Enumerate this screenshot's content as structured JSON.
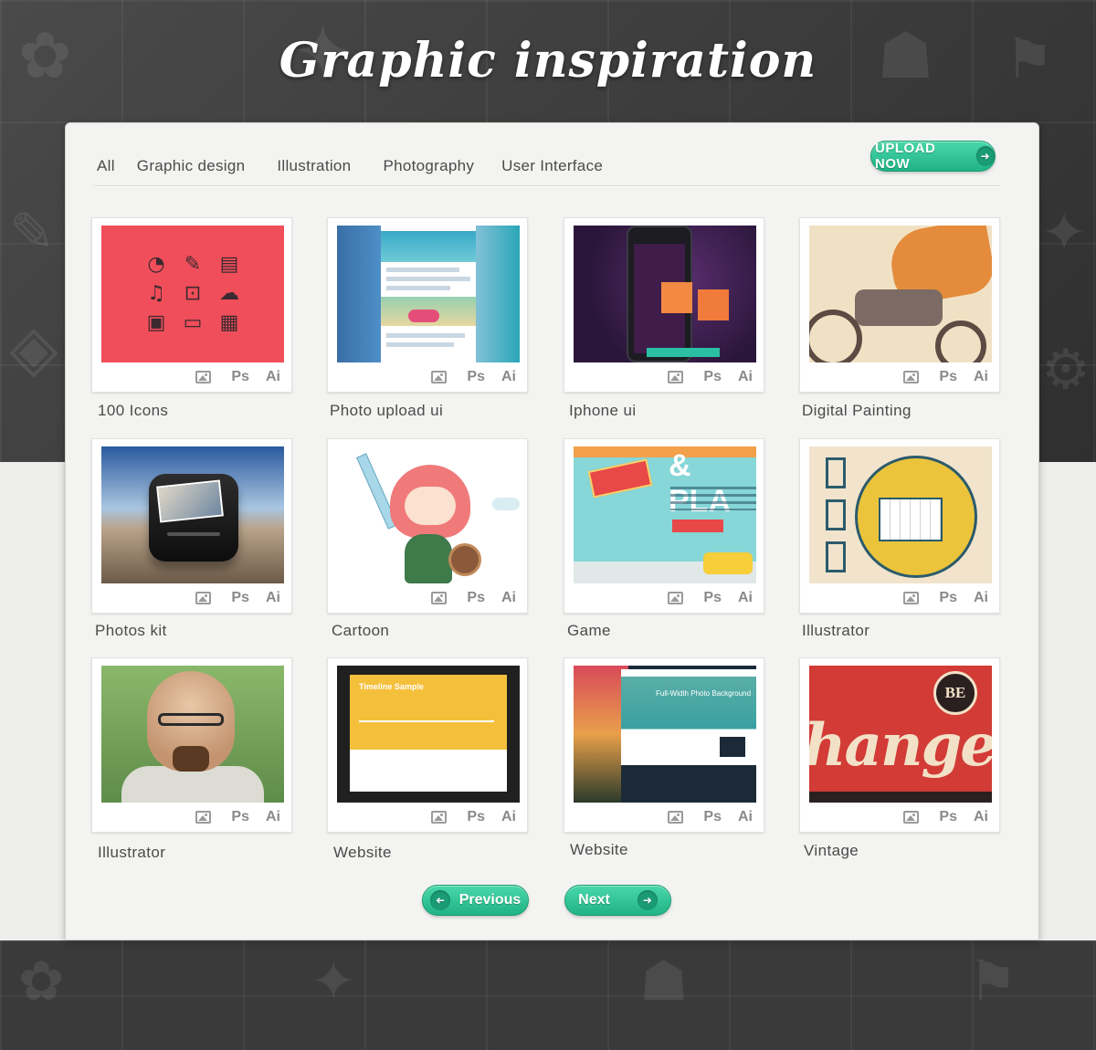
{
  "header": {
    "title": "Graphic inspiration"
  },
  "tabs": [
    {
      "label": "All"
    },
    {
      "label": "Graphic design"
    },
    {
      "label": "Illustration"
    },
    {
      "label": "Photography"
    },
    {
      "label": "User Interface"
    }
  ],
  "upload_button": {
    "label": "UPLOAD NOW",
    "icon": "arrow-right-icon"
  },
  "card_tools": {
    "image_icon": "image-icon",
    "ps_label": "Ps",
    "ai_label": "Ai"
  },
  "gallery": [
    {
      "caption": "100 Icons",
      "thumb": "icons"
    },
    {
      "caption": "Photo upload ui",
      "thumb": "upload"
    },
    {
      "caption": "Iphone ui",
      "thumb": "iphone"
    },
    {
      "caption": "Digital Painting",
      "thumb": "paint"
    },
    {
      "caption": "Photos kit",
      "thumb": "photokit"
    },
    {
      "caption": "Cartoon",
      "thumb": "cartoon"
    },
    {
      "caption": "Game",
      "thumb": "game"
    },
    {
      "caption": "Illustrator",
      "thumb": "illus1"
    },
    {
      "caption": "Illustrator",
      "thumb": "heisen"
    },
    {
      "caption": "Website",
      "thumb": "timeline"
    },
    {
      "caption": "Website",
      "thumb": "website2"
    },
    {
      "caption": "Vintage",
      "thumb": "vintage"
    }
  ],
  "thumb_text": {
    "game_word": "& PLA",
    "timeline_title": "Timeline Sample",
    "website_title": "Full-Width Photo Background",
    "vintage_badge": "BE",
    "vintage_word": "hange"
  },
  "pagination": {
    "previous_label": "Previous",
    "next_label": "Next",
    "previous_icon": "arrow-left-icon",
    "next_icon": "arrow-right-icon"
  },
  "colors": {
    "accent": "#2ac28f",
    "background_dark": "#3a3a3a",
    "panel": "#f3f3f1",
    "text": "#4b4b4b"
  }
}
